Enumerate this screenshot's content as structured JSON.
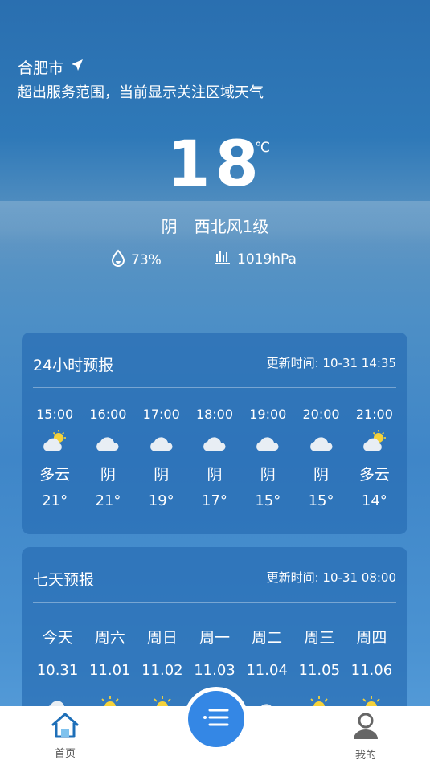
{
  "location": {
    "city": "合肥市",
    "notice": "超出服务范围，当前显示关注区域天气"
  },
  "current": {
    "temperature": "18",
    "unit": "℃",
    "condition": "阴",
    "wind": "西北风1级",
    "humidity": "73%",
    "pressure": "1019hPa"
  },
  "hourly": {
    "title": "24小时预报",
    "updated": "更新时间: 10-31 14:35",
    "items": [
      {
        "time": "15:00",
        "icon": "partly-cloudy-icon",
        "desc": "多云",
        "temp": "21°"
      },
      {
        "time": "16:00",
        "icon": "cloud-icon",
        "desc": "阴",
        "temp": "21°"
      },
      {
        "time": "17:00",
        "icon": "cloud-icon",
        "desc": "阴",
        "temp": "19°"
      },
      {
        "time": "18:00",
        "icon": "cloud-icon",
        "desc": "阴",
        "temp": "17°"
      },
      {
        "time": "19:00",
        "icon": "cloud-icon",
        "desc": "阴",
        "temp": "15°"
      },
      {
        "time": "20:00",
        "icon": "cloud-icon",
        "desc": "阴",
        "temp": "15°"
      },
      {
        "time": "21:00",
        "icon": "partly-cloudy-icon",
        "desc": "多云",
        "temp": "14°"
      }
    ]
  },
  "weekly": {
    "title": "七天预报",
    "updated": "更新时间: 10-31 08:00",
    "items": [
      {
        "day": "今天",
        "date": "10.31",
        "icon": "cloud-icon"
      },
      {
        "day": "周六",
        "date": "11.01",
        "icon": "sun-icon"
      },
      {
        "day": "周日",
        "date": "11.02",
        "icon": "partly-cloudy-icon"
      },
      {
        "day": "周一",
        "date": "11.03",
        "icon": "cloud-icon"
      },
      {
        "day": "周二",
        "date": "11.04",
        "icon": "cloud-icon"
      },
      {
        "day": "周三",
        "date": "11.05",
        "icon": "sun-icon"
      },
      {
        "day": "周四",
        "date": "11.06",
        "icon": "sun-icon"
      }
    ]
  },
  "nav": {
    "home": "首页",
    "mine": "我的"
  },
  "colors": {
    "accent": "#3487e5"
  }
}
